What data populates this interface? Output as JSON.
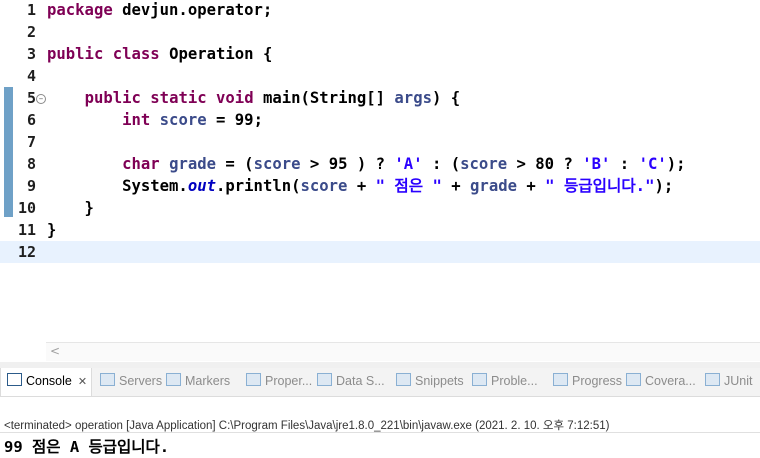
{
  "editor": {
    "lines": [
      {
        "n": "1",
        "html": "<span class='kw'>package</span> devjun.operator;"
      },
      {
        "n": "2",
        "html": ""
      },
      {
        "n": "3",
        "html": "<span class='kw'>public</span> <span class='kw'>class</span> Operation {"
      },
      {
        "n": "4",
        "html": ""
      },
      {
        "n": "5",
        "html": "    <span class='kw'>public</span> <span class='kw'>static</span> <span class='kw'>void</span> main(String[] <span class='var'>args</span>) {"
      },
      {
        "n": "6",
        "html": "        <span class='kw'>int</span> <span class='var'>score</span> = 99;"
      },
      {
        "n": "7",
        "html": ""
      },
      {
        "n": "8",
        "html": "        <span class='kw'>char</span> <span class='var'>grade</span> = (<span class='var'>score</span> > 95 ) ? <span class='str'>'A'</span> : (<span class='var'>score</span> > 80 ? <span class='str'>'B'</span> : <span class='str'>'C'</span>);"
      },
      {
        "n": "9",
        "html": "        System.<span class='stat'>out</span>.println(<span class='var'>score</span> + <span class='str'>\" 점은 \"</span> + <span class='var'>grade</span> + <span class='str'>\" 등급입니다.\"</span>);"
      },
      {
        "n": "10",
        "html": "    }"
      },
      {
        "n": "11",
        "html": "}"
      },
      {
        "n": "12",
        "html": ""
      }
    ]
  },
  "tabs": [
    {
      "label": "Console",
      "name": "tab-console",
      "active": true
    },
    {
      "label": "Servers",
      "name": "tab-servers"
    },
    {
      "label": "Markers",
      "name": "tab-markers"
    },
    {
      "label": "Proper...",
      "name": "tab-properties"
    },
    {
      "label": "Data S...",
      "name": "tab-data-source"
    },
    {
      "label": "Snippets",
      "name": "tab-snippets"
    },
    {
      "label": "Proble...",
      "name": "tab-problems"
    },
    {
      "label": "Progress",
      "name": "tab-progress"
    },
    {
      "label": "Covera...",
      "name": "tab-coverage"
    },
    {
      "label": "JUnit",
      "name": "tab-junit"
    }
  ],
  "console": {
    "terminated": "<terminated> operation [Java Application] C:\\Program Files\\Java\\jre1.8.0_221\\bin\\javaw.exe (2021. 2. 10. 오후 7:12:51)",
    "output": "99 점은 A 등급입니다."
  }
}
